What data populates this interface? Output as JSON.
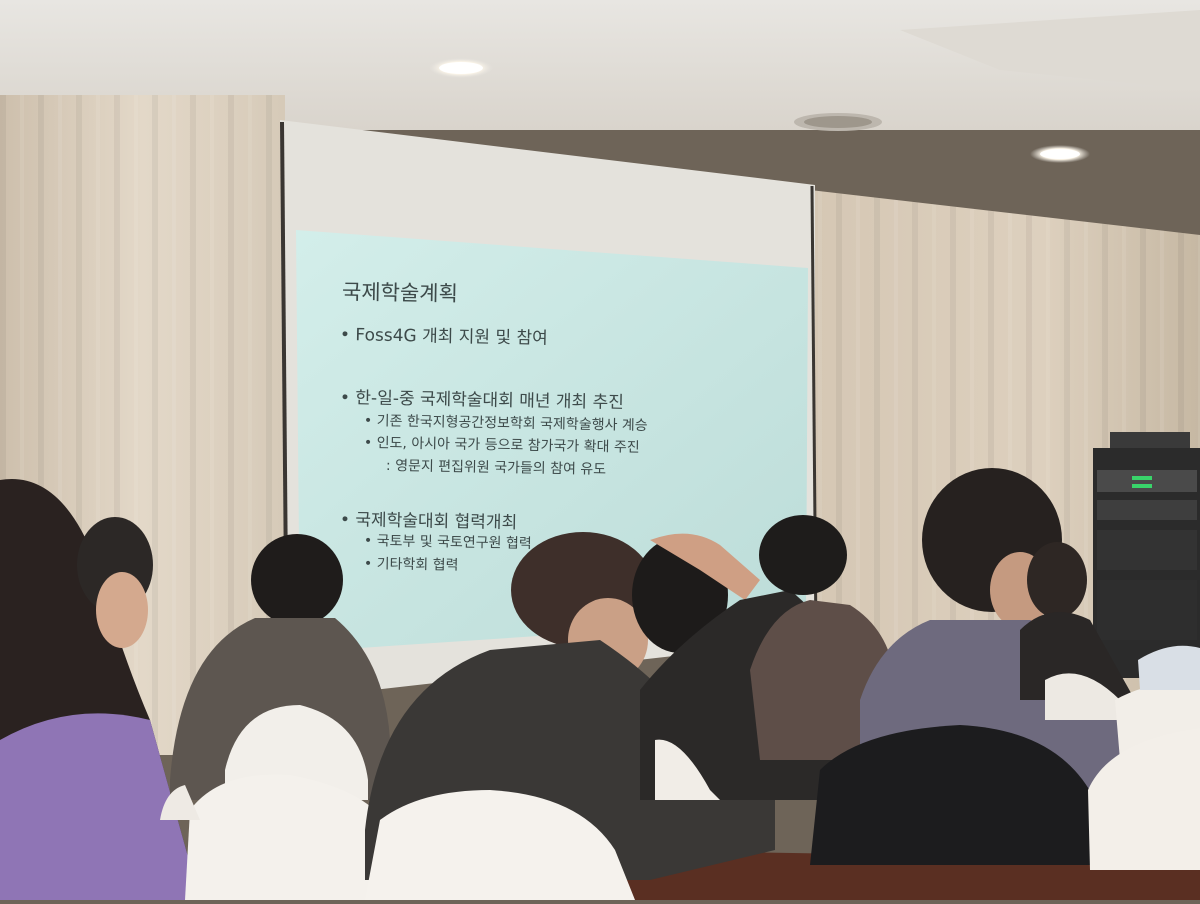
{
  "slide": {
    "title": "국제학술계획",
    "bullet_1": "• Foss4G 개최 지원 및 참여",
    "bullet_2": "• 한-일-중 국제학술대회 매년 개최 추진",
    "sub_2a": "• 기존 한국지형공간정보학회 국제학술행사 계승",
    "sub_2b": "• 인도, 아시아 국가 등으로 참가국가 확대 주진",
    "sub_2c": ": 영문지 편집위원 국가들의 참여 유도",
    "bullet_3": "• 국제학술대회 협력개최",
    "sub_3a": "• 국토부 및 국토연구원 협력",
    "sub_3b": "• 기타학회 협력"
  },
  "colors": {
    "ceiling": "#ece9e4",
    "curtain": "#d8cdbd",
    "screen_glow": "#c9e6e2",
    "slide_text": "#3d4a4a",
    "equipment_led": "#39d46a"
  }
}
